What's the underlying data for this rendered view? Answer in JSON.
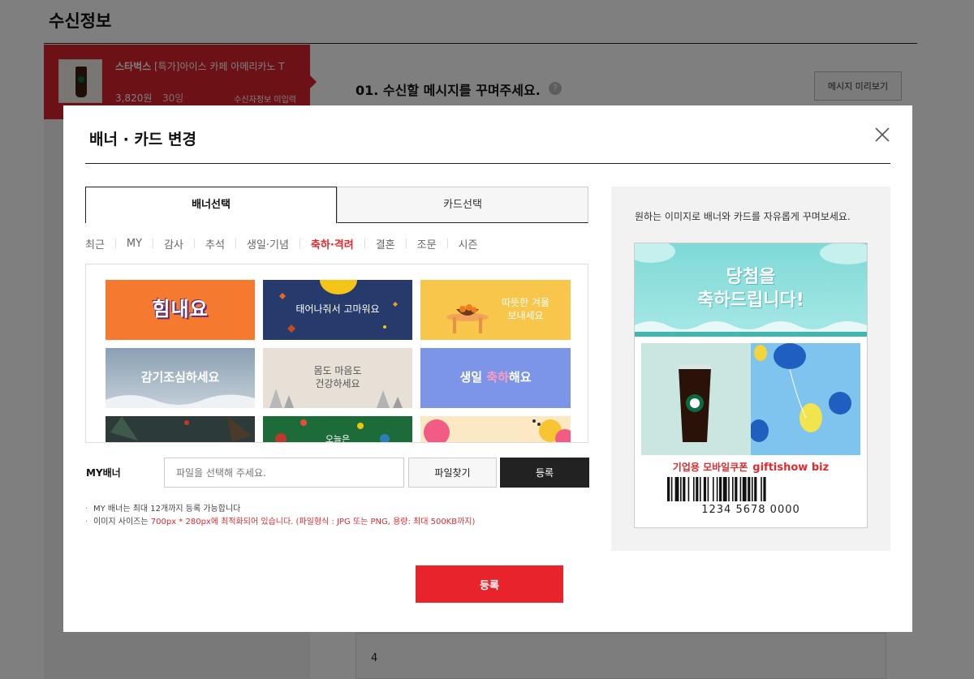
{
  "background": {
    "section_title": "수신정보",
    "product": {
      "brand": "스타벅스",
      "name": "[특가]아이스 카페 아메리카노 T",
      "price": "3,820원",
      "quantity": "30잉",
      "receiver_status": "수신자정보 미입력"
    },
    "step_heading": "01. 수신할 메시지를 꾸며주세요.",
    "help_glyph": "?",
    "preview_button": "메시지 미리보기",
    "bottom_number": "4"
  },
  "modal": {
    "title": "배너 · 카드 변경",
    "close_icon": "close-icon",
    "tabs": [
      {
        "label": "배너선택",
        "active": true
      },
      {
        "label": "카드선택",
        "active": false
      }
    ],
    "categories": [
      {
        "label": "최근",
        "active": false
      },
      {
        "label": "MY",
        "active": false
      },
      {
        "label": "감사",
        "active": false
      },
      {
        "label": "추석",
        "active": false
      },
      {
        "label": "생일·기념",
        "active": false
      },
      {
        "label": "축하·격려",
        "active": true
      },
      {
        "label": "결혼",
        "active": false
      },
      {
        "label": "조문",
        "active": false
      },
      {
        "label": "시즌",
        "active": false
      }
    ],
    "banners": [
      {
        "text": "힘내요"
      },
      {
        "text": "태어나줘서 고마워요"
      },
      {
        "text": "따뜻한 겨울\n보내세요"
      },
      {
        "text": "감기조심하세요"
      },
      {
        "text": "몸도 마음도\n건강하세요"
      },
      {
        "text_pre": "생일 ",
        "text_accent": "축하",
        "text_post": "해요"
      },
      {
        "text": ""
      },
      {
        "text": "오늘은"
      },
      {
        "text": ""
      }
    ],
    "my_banner": {
      "label": "MY배너",
      "placeholder": "파일을 선택해 주세요.",
      "find_button": "파일찾기",
      "register_button": "등록"
    },
    "notes": {
      "line1": "MY 배너는 최대 12개까지 등록 가능합니다",
      "line2_prefix": "이미지 사이즈는 ",
      "line2_size": "700px * 280px",
      "line2_suffix": "에 최적화되어 있습니다. (파일형식 : JPG 또는 PNG, 용량: 최대 500KB까지)"
    },
    "submit_button": "등록",
    "preview": {
      "description": "원하는 이미지로 배너와 카드를 자유롭게 꾸며보세요.",
      "banner_text": "당첨을\n축하드립니다!",
      "tag_label": "기업용 모바일쿠폰",
      "tag_brand": "giftishow biz",
      "barcode_number": "1234 5678 0000"
    }
  },
  "colors": {
    "accent_red": "#e8232b",
    "product_red": "#d9232b",
    "dark_button": "#222222"
  }
}
